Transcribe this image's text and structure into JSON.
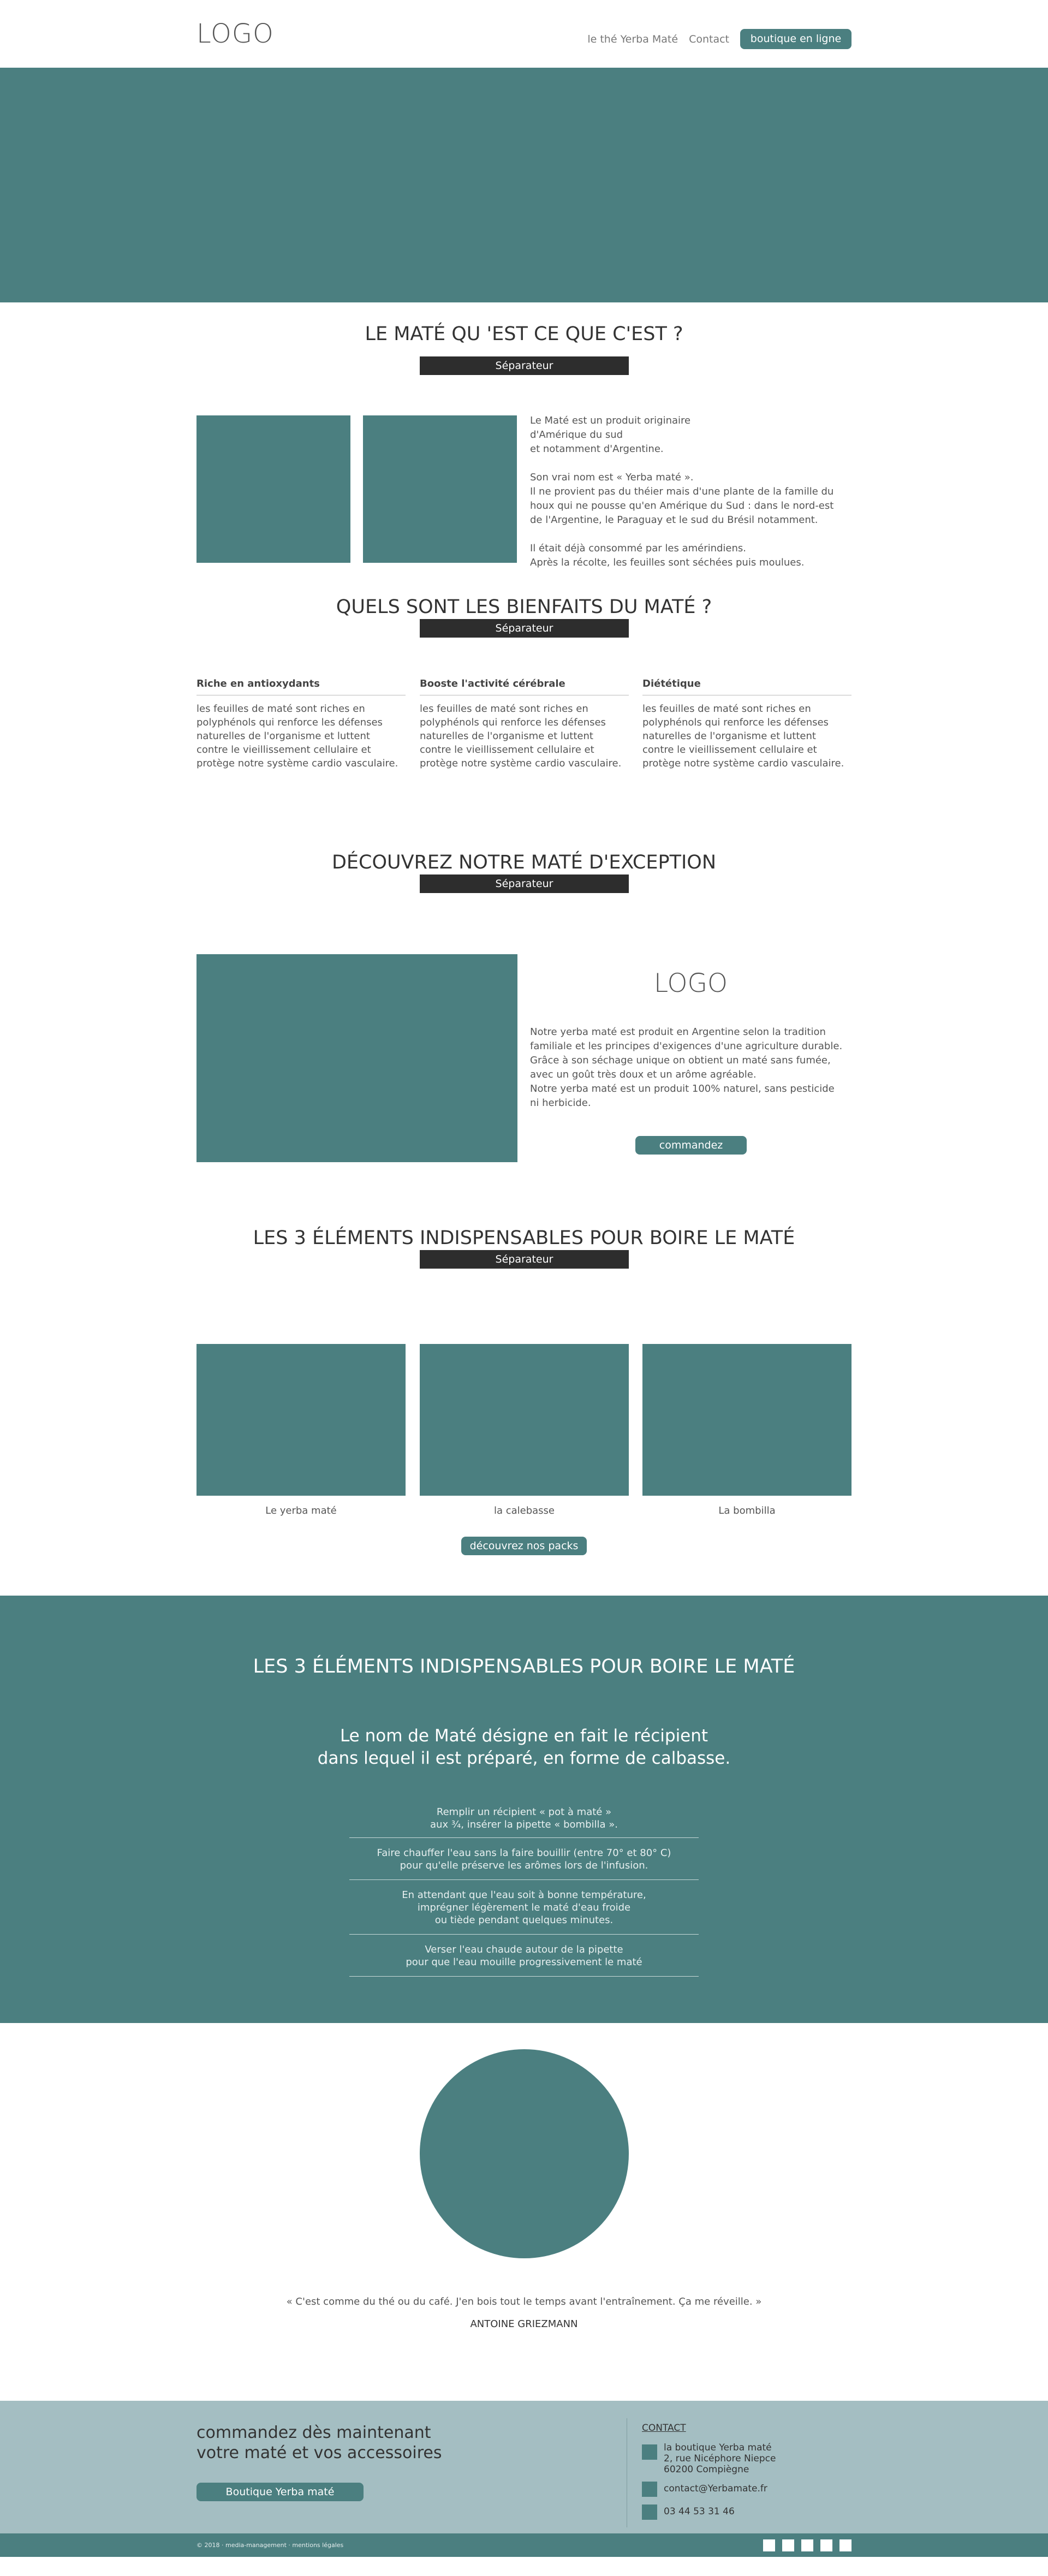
{
  "header": {
    "logo": "LOGO",
    "nav": [
      "le thé Yerba Maté",
      "Contact"
    ],
    "cta": "boutique en ligne"
  },
  "section1": {
    "title": "LE MATÉ QU 'EST CE QUE C'EST ?",
    "separator": "Séparateur",
    "text": [
      "Le Maté est un produit originaire",
      "d'Amérique du sud",
      "et notamment d'Argentine.",
      "",
      "Son vrai nom est « Yerba maté ».",
      "Il ne provient pas du théier mais d'une plante de la famille du",
      "houx qui ne pousse qu'en Amérique du Sud : dans le nord-est",
      "de l'Argentine, le Paraguay et le sud du Brésil notamment.",
      "",
      "Il était déjà consommé par les amérindiens.",
      "Après la récolte, les feuilles sont séchées puis moulues."
    ]
  },
  "section2": {
    "title": "QUELS SONT LES BIENFAITS DU MATÉ ?",
    "separator": "Séparateur",
    "benefits": [
      {
        "title": "Riche en antioxydants",
        "lines": [
          "les feuilles de maté sont riches en",
          "polyphénols qui renforce les défenses",
          "naturelles de l'organisme et luttent",
          "contre le vieillissement cellulaire et",
          "protège notre système cardio vasculaire."
        ]
      },
      {
        "title": "Booste l'activité cérébrale",
        "lines": [
          "les feuilles de maté sont riches en",
          "polyphénols qui renforce les défenses",
          "naturelles de l'organisme et luttent",
          "contre le vieillissement cellulaire et",
          "protège notre système cardio vasculaire."
        ]
      },
      {
        "title": "Diététique",
        "lines": [
          "les feuilles de maté sont riches en",
          "polyphénols qui renforce les défenses",
          "naturelles de l'organisme et luttent",
          "contre le vieillissement cellulaire et",
          "protège notre système cardio vasculaire."
        ]
      }
    ]
  },
  "section3": {
    "title": "DÉCOUVREZ NOTRE MATÉ D'EXCEPTION",
    "separator": "Séparateur",
    "logo": "LOGO",
    "text": [
      "Notre yerba maté est produit  en Argentine selon la tradition",
      "familiale et les principes d'exigences d'une agriculture durable.",
      "Grâce à son séchage unique on obtient un maté sans fumée,",
      "avec un goût très doux et un arôme agréable.",
      "Notre yerba maté est un produit 100% naturel, sans pesticide",
      "ni herbicide."
    ],
    "cta": "commandez"
  },
  "section4": {
    "title": "LES 3 ÉLÉMENTS INDISPENSABLES POUR BOIRE LE MATÉ",
    "separator": "Séparateur",
    "items": [
      "Le yerba maté",
      "la calebasse",
      "La bombilla"
    ],
    "cta": "découvrez nos packs"
  },
  "section5": {
    "title": "LES 3 ÉLÉMENTS INDISPENSABLES POUR BOIRE LE MATÉ",
    "subtitle": [
      "Le nom de Maté désigne en fait le récipient",
      "dans lequel il est préparé, en forme de calbasse."
    ],
    "steps": [
      [
        "Remplir un récipient « pot à maté »",
        "aux ¾, insérer la pipette « bombilla »."
      ],
      [
        "Faire chauffer l'eau sans la faire bouillir (entre 70° et 80° C)",
        "pour qu'elle préserve les arômes lors de l'infusion."
      ],
      [
        "En attendant que l'eau soit à bonne température,",
        "imprégner légèrement le maté d'eau froide",
        "ou tiède pendant quelques minutes."
      ],
      [
        "Verser l'eau chaude autour de la pipette",
        "pour que l'eau mouille progressivement le maté"
      ]
    ]
  },
  "testimonial": {
    "quote": "« C'est comme du thé ou du café. J'en bois tout le temps avant l'entraînement. Ça me réveille. »",
    "author": "ANTOINE GRIEZMANN"
  },
  "footer": {
    "headline": [
      "commandez dès maintenant",
      "votre maté et vos accessoires"
    ],
    "cta": "Boutique Yerba maté",
    "contact_title": "CONTACT",
    "address": [
      "la boutique Yerba maté",
      "2, rue Nicéphore Niepce",
      "60200 Compiègne"
    ],
    "email": "contact@Yerbamate.fr",
    "phone": "03 44 53 31 46",
    "copyright": "© 2018 · media-management · mentions légales"
  },
  "colors": {
    "accent": "#4b7f80",
    "dark": "#2d2d2d",
    "footer_bg": "#a4bec2"
  }
}
